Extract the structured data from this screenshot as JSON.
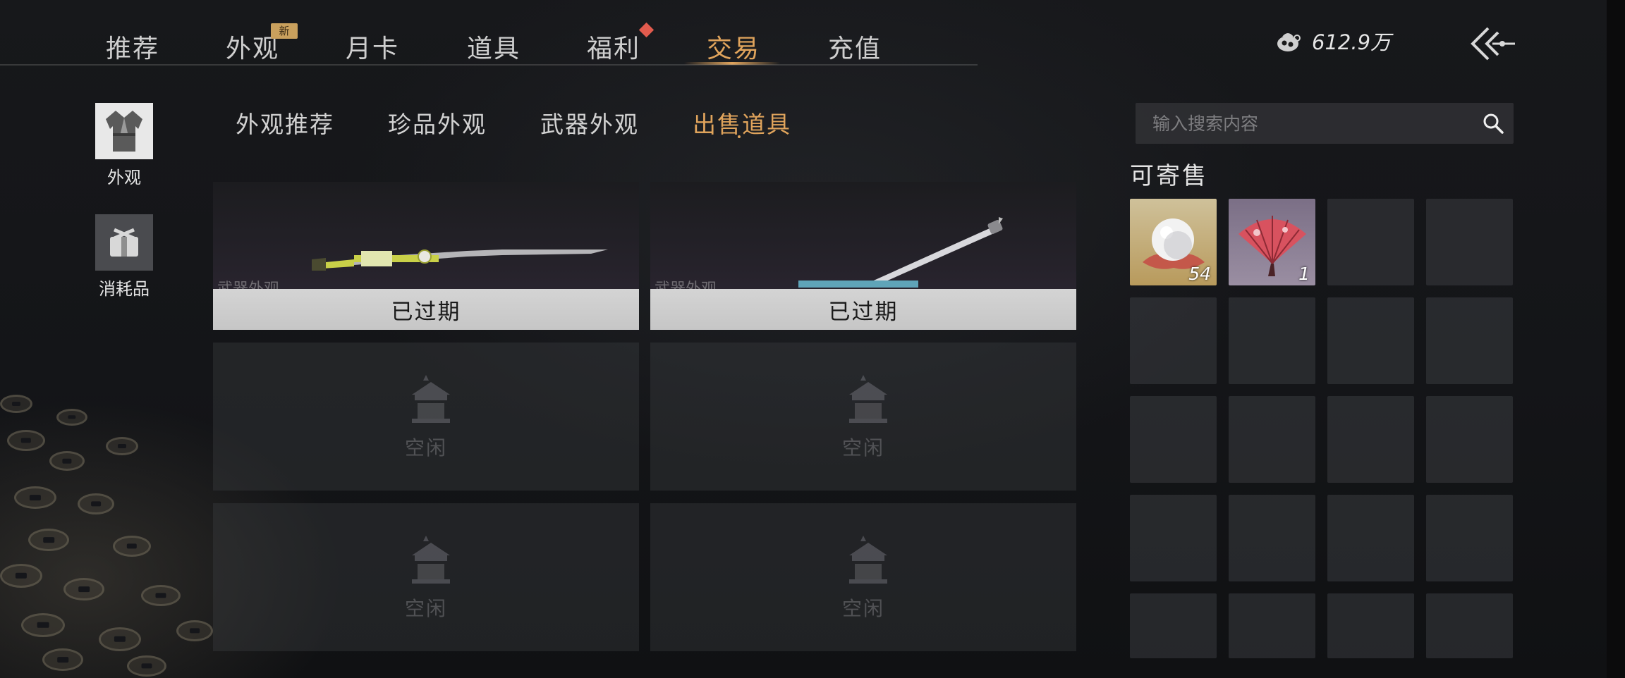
{
  "top_nav": {
    "tabs": [
      {
        "label": "推荐"
      },
      {
        "label": "外观",
        "badge": "新"
      },
      {
        "label": "月卡"
      },
      {
        "label": "道具"
      },
      {
        "label": "福利"
      },
      {
        "label": "交易"
      },
      {
        "label": "充值"
      }
    ],
    "active_tab": "交易"
  },
  "currency": {
    "icon": "coin-pouch-icon",
    "amount": "612.9万"
  },
  "sidebar": {
    "items": [
      {
        "label": "外观",
        "icon": "robe-icon",
        "selected": true
      },
      {
        "label": "消耗品",
        "icon": "package-icon",
        "selected": false
      }
    ]
  },
  "sub_tabs": {
    "items": [
      {
        "label": "外观推荐"
      },
      {
        "label": "珍品外观"
      },
      {
        "label": "武器外观"
      },
      {
        "label": "出售道具"
      }
    ],
    "active": "出售道具"
  },
  "listing_slots": [
    {
      "category": "武器外观",
      "status": "已过期",
      "item": "spear"
    },
    {
      "category": "武器外观",
      "status": "已过期",
      "item": "katana"
    },
    {
      "status": "空闲"
    },
    {
      "status": "空闲"
    },
    {
      "status": "空闲"
    },
    {
      "status": "空闲"
    }
  ],
  "search": {
    "placeholder": "输入搜索内容"
  },
  "sellable": {
    "title": "可寄售",
    "items": [
      {
        "icon": "pearl-icon",
        "quantity": "54"
      },
      {
        "icon": "folding-fan-icon",
        "quantity": "1"
      }
    ]
  },
  "colors": {
    "accent": "#e0a45c",
    "new_badge": "#c9a05d",
    "alert": "#e25b4e"
  }
}
